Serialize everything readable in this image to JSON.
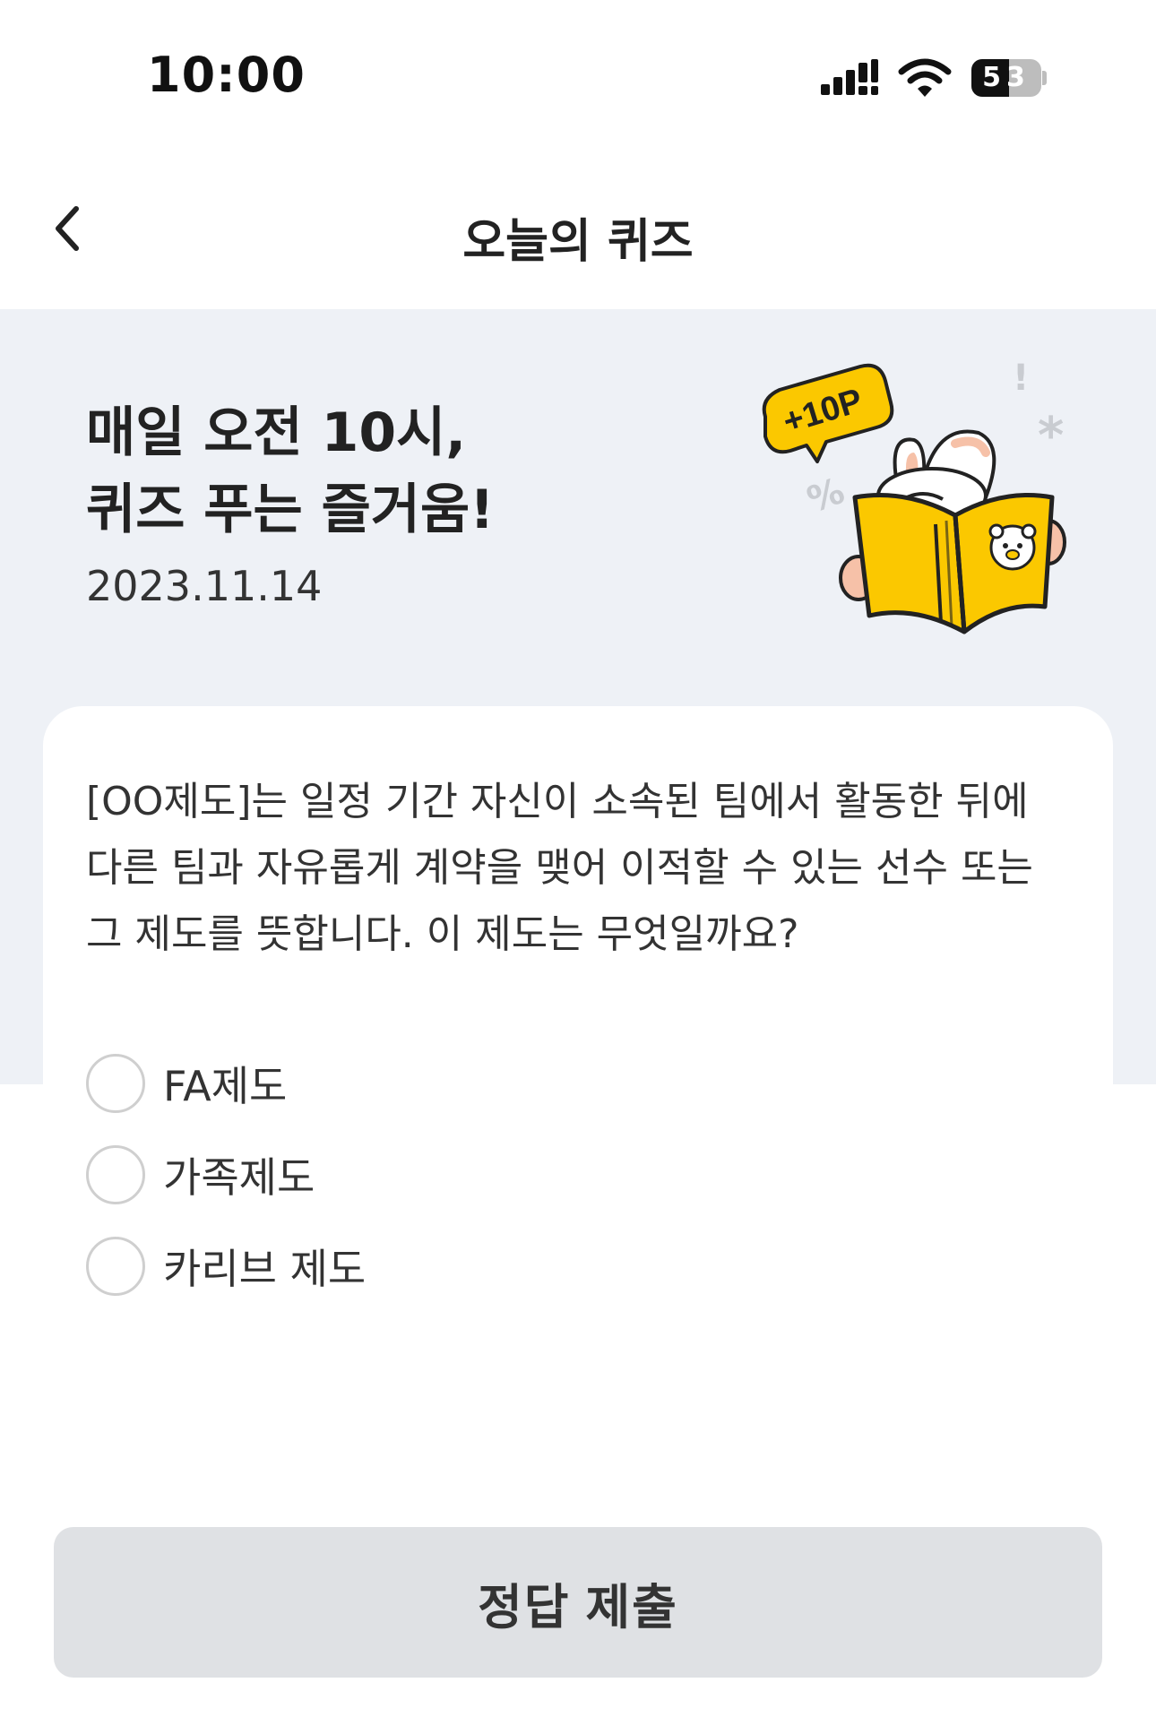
{
  "status_bar": {
    "time": "10:00",
    "battery": "53",
    "icons": [
      "signal-icon",
      "wifi-icon",
      "battery-icon"
    ]
  },
  "header": {
    "title": "오늘의 퀴즈",
    "back_icon": "chevron-left-icon"
  },
  "hero": {
    "headline_line1": "매일 오전 10시,",
    "headline_line2": "퀴즈 푸는 즐거움!",
    "date": "2023.11.14",
    "badge": "+10P"
  },
  "quiz": {
    "question_lines": [
      "[OO제도]는 일정 기간 자신이 소속된 팀에서 활동한 뒤에",
      "다른 팀과 자유롭게 계약을 맺어 이적할 수 있는 선수 또는",
      "그 제도를 뜻합니다. 이 제도는 무엇일까요?"
    ],
    "options": [
      {
        "label": "FA제도"
      },
      {
        "label": "가족제도"
      },
      {
        "label": "카리브 제도"
      }
    ]
  },
  "submit": {
    "label": "정답 제출"
  },
  "colors": {
    "hero_bg": "#eef1f6",
    "accent_yellow": "#fbc800",
    "button_bg": "#dfe1e4"
  }
}
